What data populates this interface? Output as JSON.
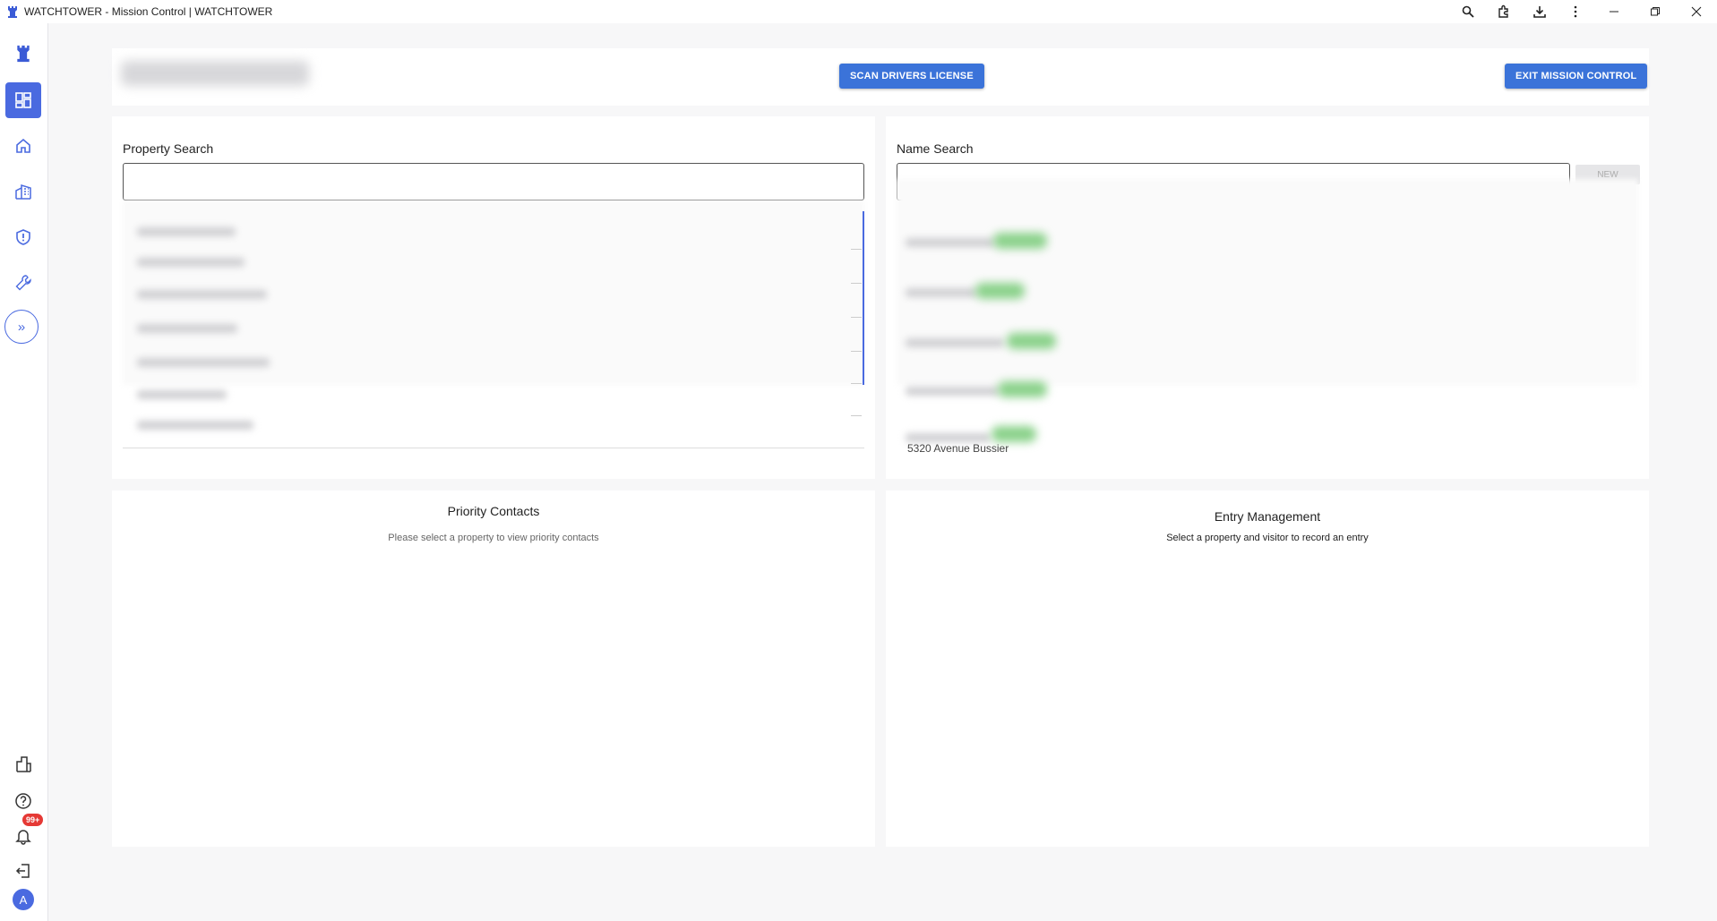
{
  "window": {
    "title": "WATCHTOWER - Mission Control | WATCHTOWER",
    "controls": [
      "zoom-icon",
      "extensions-icon",
      "download-icon",
      "more-icon",
      "minimize-icon",
      "restore-icon",
      "close-icon"
    ]
  },
  "sidebar": {
    "top_items": [
      "dashboard-icon",
      "home-icon",
      "buildings-icon",
      "shield-icon",
      "wrench-icon"
    ],
    "expand_label": "»",
    "bottom_items": [
      "building-icon",
      "help-icon",
      "bell-icon",
      "logout-icon"
    ],
    "notification_badge": "99+",
    "avatar_initial": "A"
  },
  "header": {
    "scan_label": "SCAN DRIVERS LICENSE",
    "exit_label": "EXIT MISSION CONTROL"
  },
  "property_search": {
    "label": "Property Search"
  },
  "name_search": {
    "label": "Name Search",
    "new_label": "NEW",
    "partial_result": "5320 Avenue Bussier"
  },
  "priority_contacts": {
    "title": "Priority Contacts",
    "message": "Please select a property to view priority contacts"
  },
  "entry_management": {
    "title": "Entry Management",
    "message": "Select a property and visitor to record an entry"
  },
  "colors": {
    "accent": "#4a6ae0",
    "button": "#3b73d9",
    "badge": "#e53935"
  }
}
